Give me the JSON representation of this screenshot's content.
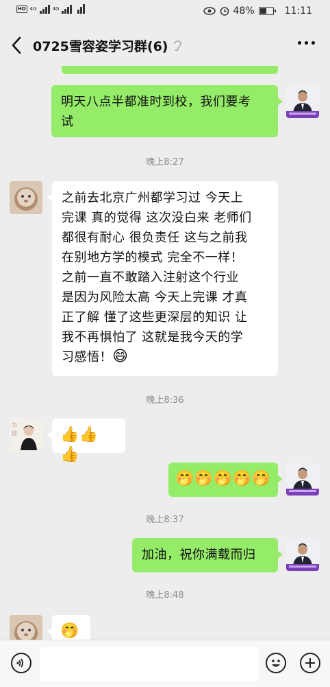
{
  "status": {
    "hd1": "HD",
    "hd2": "HD",
    "net1": "4G",
    "net2": "4G",
    "battery": "48%",
    "time": "11:11"
  },
  "header": {
    "title": "0725雪容姿学习群(6)"
  },
  "messages": [
    {
      "side": "right",
      "text": "明天八点半都准时到校，我们要考试"
    },
    {
      "time": "晚上8:27"
    },
    {
      "side": "left",
      "text": "之前去北京广州都学习过  今天上完课  真的觉得 这次没白来  老师们都很有耐心  很负责任  这与之前我在别地方学的模式  完全不一样！之前一直不敢踏入注射这个行业是因为风险太高  今天上完课  才真正了解  懂了这些更深层的知识  让我不再惧怕了  这就是我今天的学习感悟！😄"
    },
    {
      "time": "晚上8:36"
    },
    {
      "side": "left",
      "text": "👍👍👍"
    },
    {
      "side": "right",
      "text": "🤭🤭🤭🤭🤭"
    },
    {
      "time": "晚上8:37"
    },
    {
      "side": "right",
      "text": "加油，祝你满载而归"
    },
    {
      "time": "晚上8:48"
    },
    {
      "side": "left",
      "text": "🤭"
    }
  ],
  "lines": {
    "m1a": "明天八点半都准时到校，我们要考",
    "m1b": "试",
    "m2": [
      "之前去北京广州都学习过  今天上",
      "完课  真的觉得 这次没白来  老师们",
      "都很有耐心  很负责任  这与之前我",
      "在别地方学的模式  完全不一样！",
      "之前一直不敢踏入注射这个行业",
      "是因为风险太高  今天上完课  才真",
      "正了解  懂了这些更深层的知识  让",
      "我不再惧怕了  这就是我今天的学",
      "习感悟！"
    ],
    "m2emoji": "😄"
  },
  "icons": {
    "back": "back-arrow-icon",
    "ear": "ear-icon",
    "more": "more-dots-icon",
    "voice": "voice-icon",
    "emoji": "emoji-icon",
    "plus": "plus-icon"
  },
  "colors": {
    "sent_bubble": "#95ec69",
    "received_bubble": "#ffffff",
    "background": "#ededed"
  }
}
